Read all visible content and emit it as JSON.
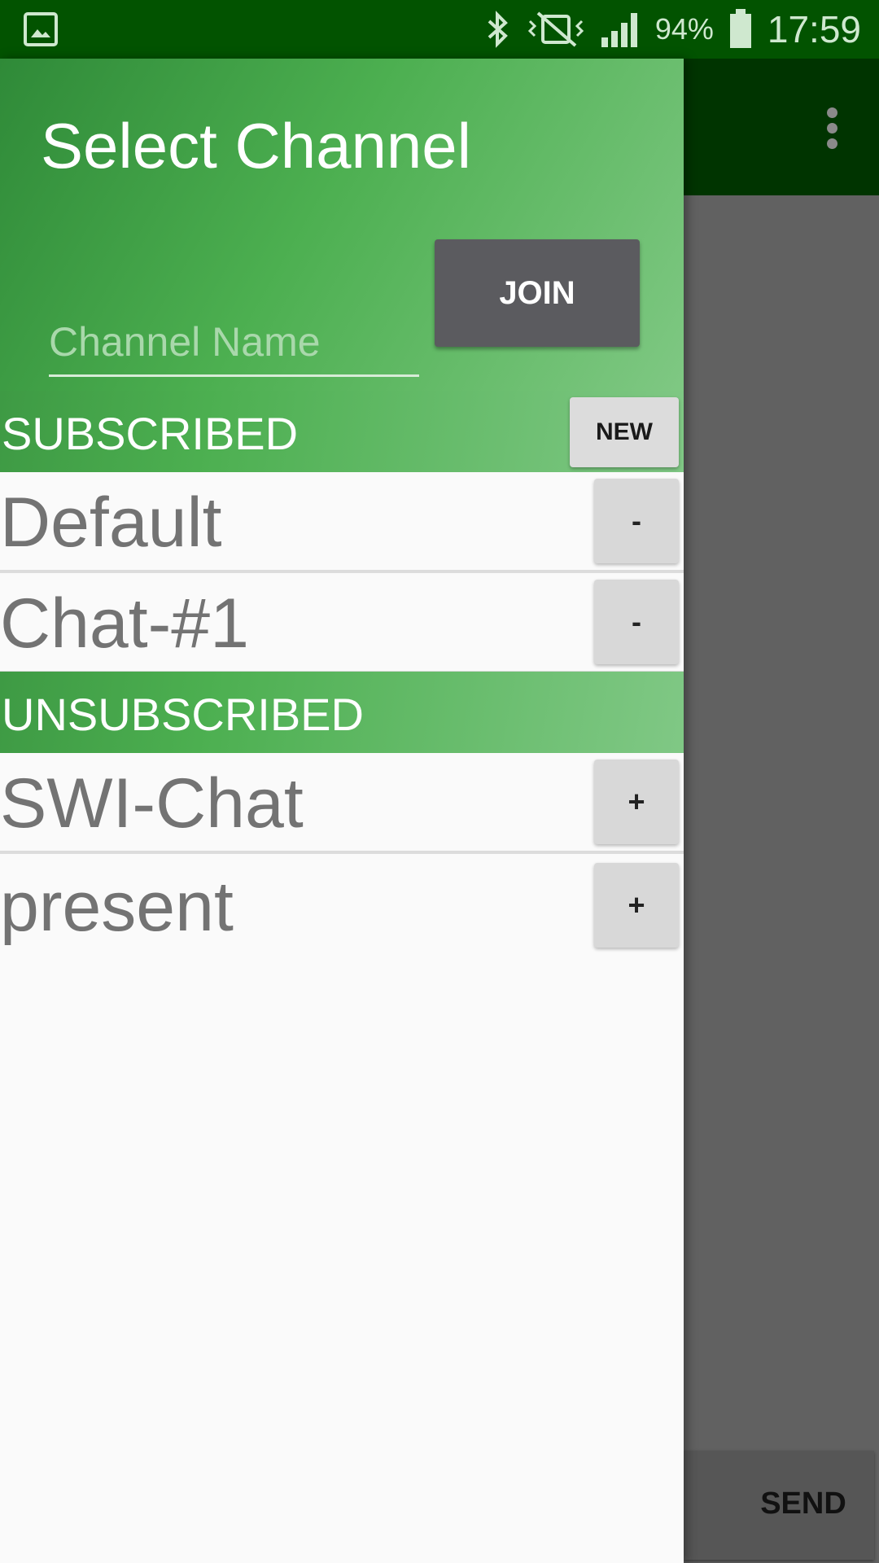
{
  "status_bar": {
    "battery_percent": "94%",
    "time": "17:59",
    "icons": [
      "gallery-icon",
      "bluetooth-icon",
      "vibrate-icon",
      "signal-icon",
      "battery-icon"
    ]
  },
  "drawer": {
    "title": "Select Channel",
    "channel_input": {
      "placeholder": "Channel Name",
      "value": ""
    },
    "join_label": "JOIN",
    "subscribed": {
      "title": "SUBSCRIBED",
      "new_label": "NEW",
      "channels": [
        {
          "name": "Default",
          "action": "-"
        },
        {
          "name": "Chat-#1",
          "action": "-"
        }
      ]
    },
    "unsubscribed": {
      "title": "UNSUBSCRIBED",
      "channels": [
        {
          "name": "SWI-Chat",
          "action": "+"
        },
        {
          "name": "present",
          "action": "+"
        }
      ]
    }
  },
  "app": {
    "send_label": "SEND"
  },
  "colors": {
    "status_bar": "#025300",
    "toolbar": "#003400",
    "accent_green": "#4caf50",
    "join_button": "#5b5b5f",
    "channel_text": "#737373"
  }
}
